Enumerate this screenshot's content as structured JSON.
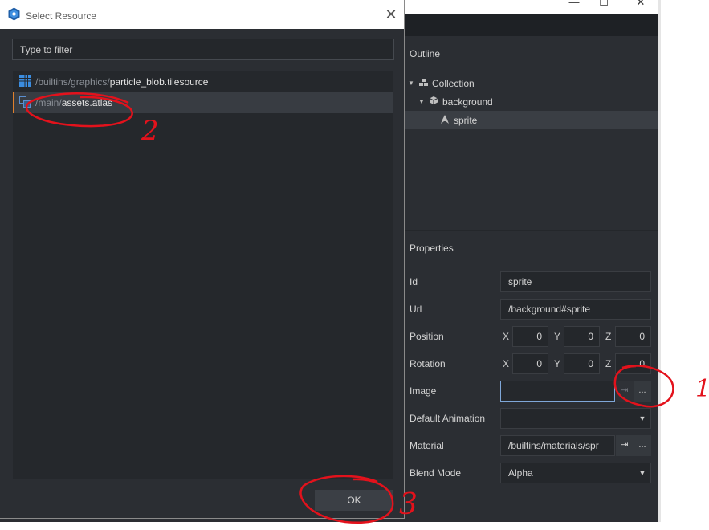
{
  "editor": {
    "window_controls": {
      "minimize": "—",
      "maximize": "☐",
      "close": "✕"
    },
    "outline": {
      "title": "Outline",
      "items": [
        {
          "label": "Collection",
          "icon": "collection-icon",
          "expanded": true
        },
        {
          "label": "background",
          "icon": "game-object-icon",
          "expanded": true
        },
        {
          "label": "sprite",
          "icon": "sprite-icon",
          "selected": true
        }
      ]
    },
    "properties": {
      "title": "Properties",
      "id": {
        "label": "Id",
        "value": "sprite"
      },
      "url": {
        "label": "Url",
        "value": "/background#sprite"
      },
      "position": {
        "label": "Position",
        "x_label": "X",
        "y_label": "Y",
        "z_label": "Z",
        "x": "0",
        "y": "0",
        "z": "0"
      },
      "rotation": {
        "label": "Rotation",
        "x_label": "X",
        "y_label": "Y",
        "z_label": "Z",
        "x": "0",
        "y": "0",
        "z": "0"
      },
      "image": {
        "label": "Image",
        "value": "",
        "goto_icon": "goto-icon",
        "browse_label": "..."
      },
      "default_animation": {
        "label": "Default Animation",
        "value": ""
      },
      "material": {
        "label": "Material",
        "value": "/builtins/materials/spr",
        "goto_icon": "goto-icon",
        "browse_label": "..."
      },
      "blend_mode": {
        "label": "Blend Mode",
        "value": "Alpha"
      }
    }
  },
  "dialog": {
    "title": "Select Resource",
    "close_label": "✕",
    "filter_placeholder": "Type to filter",
    "results": [
      {
        "path": "/builtins/graphics/",
        "name": "particle_blob.tilesource",
        "icon": "tilesource-icon",
        "selected": false
      },
      {
        "path": "/main/",
        "name": "assets.atlas",
        "icon": "atlas-icon",
        "selected": true
      }
    ],
    "ok_label": "OK"
  },
  "annotations": {
    "mark_1": "1",
    "mark_2": "2",
    "mark_3": "3",
    "color": "#e3121c"
  }
}
